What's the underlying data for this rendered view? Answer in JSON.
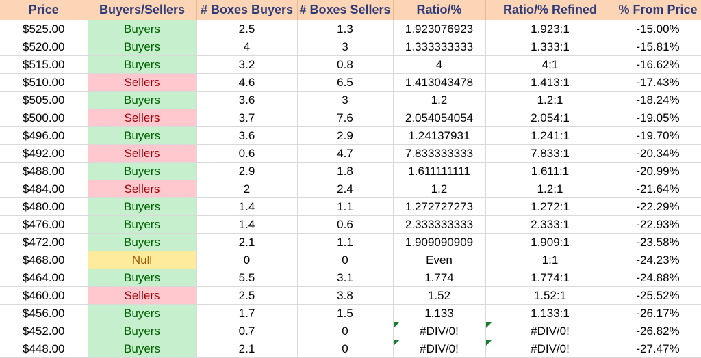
{
  "columns": [
    "Price",
    "Buyers/Sellers",
    "# Boxes Buyers",
    "# Boxes Sellers",
    "Ratio/%",
    "Ratio/% Refined",
    "% From Price"
  ],
  "colors": {
    "header_bg": "#fbd5b5",
    "header_text": "#2e3a78",
    "buyers_bg": "#c6efce",
    "buyers_text": "#006100",
    "sellers_bg": "#ffc7ce",
    "sellers_text": "#9c0006",
    "null_bg": "#ffeb9c",
    "null_text": "#9c5700",
    "error_flag": "#1e7b34"
  },
  "rows": [
    {
      "price": "$525.00",
      "side": "Buyers",
      "boxes_buyers": "2.5",
      "boxes_sellers": "1.3",
      "ratio": "1.923076923",
      "ratio_refined": "1.923:1",
      "pct_from_price": "-15.00%"
    },
    {
      "price": "$520.00",
      "side": "Buyers",
      "boxes_buyers": "4",
      "boxes_sellers": "3",
      "ratio": "1.333333333",
      "ratio_refined": "1.333:1",
      "pct_from_price": "-15.81%"
    },
    {
      "price": "$515.00",
      "side": "Buyers",
      "boxes_buyers": "3.2",
      "boxes_sellers": "0.8",
      "ratio": "4",
      "ratio_refined": "4:1",
      "pct_from_price": "-16.62%"
    },
    {
      "price": "$510.00",
      "side": "Sellers",
      "boxes_buyers": "4.6",
      "boxes_sellers": "6.5",
      "ratio": "1.413043478",
      "ratio_refined": "1.413:1",
      "pct_from_price": "-17.43%"
    },
    {
      "price": "$505.00",
      "side": "Buyers",
      "boxes_buyers": "3.6",
      "boxes_sellers": "3",
      "ratio": "1.2",
      "ratio_refined": "1.2:1",
      "pct_from_price": "-18.24%"
    },
    {
      "price": "$500.00",
      "side": "Sellers",
      "boxes_buyers": "3.7",
      "boxes_sellers": "7.6",
      "ratio": "2.054054054",
      "ratio_refined": "2.054:1",
      "pct_from_price": "-19.05%"
    },
    {
      "price": "$496.00",
      "side": "Buyers",
      "boxes_buyers": "3.6",
      "boxes_sellers": "2.9",
      "ratio": "1.24137931",
      "ratio_refined": "1.241:1",
      "pct_from_price": "-19.70%"
    },
    {
      "price": "$492.00",
      "side": "Sellers",
      "boxes_buyers": "0.6",
      "boxes_sellers": "4.7",
      "ratio": "7.833333333",
      "ratio_refined": "7.833:1",
      "pct_from_price": "-20.34%"
    },
    {
      "price": "$488.00",
      "side": "Buyers",
      "boxes_buyers": "2.9",
      "boxes_sellers": "1.8",
      "ratio": "1.611111111",
      "ratio_refined": "1.611:1",
      "pct_from_price": "-20.99%"
    },
    {
      "price": "$484.00",
      "side": "Sellers",
      "boxes_buyers": "2",
      "boxes_sellers": "2.4",
      "ratio": "1.2",
      "ratio_refined": "1.2:1",
      "pct_from_price": "-21.64%"
    },
    {
      "price": "$480.00",
      "side": "Buyers",
      "boxes_buyers": "1.4",
      "boxes_sellers": "1.1",
      "ratio": "1.272727273",
      "ratio_refined": "1.272:1",
      "pct_from_price": "-22.29%"
    },
    {
      "price": "$476.00",
      "side": "Buyers",
      "boxes_buyers": "1.4",
      "boxes_sellers": "0.6",
      "ratio": "2.333333333",
      "ratio_refined": "2.333:1",
      "pct_from_price": "-22.93%"
    },
    {
      "price": "$472.00",
      "side": "Buyers",
      "boxes_buyers": "2.1",
      "boxes_sellers": "1.1",
      "ratio": "1.909090909",
      "ratio_refined": "1.909:1",
      "pct_from_price": "-23.58%"
    },
    {
      "price": "$468.00",
      "side": "Null",
      "boxes_buyers": "0",
      "boxes_sellers": "0",
      "ratio": "Even",
      "ratio_refined": "1:1",
      "pct_from_price": "-24.23%"
    },
    {
      "price": "$464.00",
      "side": "Buyers",
      "boxes_buyers": "5.5",
      "boxes_sellers": "3.1",
      "ratio": "1.774",
      "ratio_refined": "1.774:1",
      "pct_from_price": "-24.88%"
    },
    {
      "price": "$460.00",
      "side": "Sellers",
      "boxes_buyers": "2.5",
      "boxes_sellers": "3.8",
      "ratio": "1.52",
      "ratio_refined": "1.52:1",
      "pct_from_price": "-25.52%"
    },
    {
      "price": "$456.00",
      "side": "Buyers",
      "boxes_buyers": "1.7",
      "boxes_sellers": "1.5",
      "ratio": "1.133",
      "ratio_refined": "1.133:1",
      "pct_from_price": "-26.17%"
    },
    {
      "price": "$452.00",
      "side": "Buyers",
      "boxes_buyers": "0.7",
      "boxes_sellers": "0",
      "ratio": "#DIV/0!",
      "ratio_refined": "#DIV/0!",
      "pct_from_price": "-26.82%",
      "error": true
    },
    {
      "price": "$448.00",
      "side": "Buyers",
      "boxes_buyers": "2.1",
      "boxes_sellers": "0",
      "ratio": "#DIV/0!",
      "ratio_refined": "#DIV/0!",
      "pct_from_price": "-27.47%",
      "error": true
    }
  ]
}
